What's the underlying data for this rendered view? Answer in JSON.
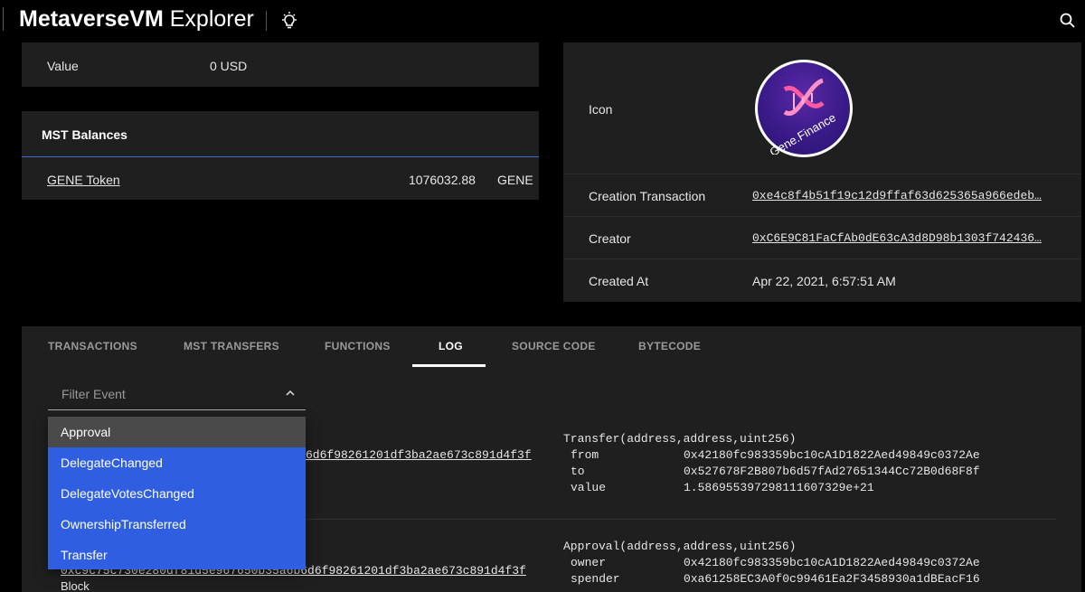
{
  "header": {
    "brand_bold": "MetaverseVM",
    "brand_light": " Explorer"
  },
  "value_card": {
    "label": "Value",
    "value": "0 USD"
  },
  "balances": {
    "title": "MST Balances",
    "rows": [
      {
        "token": "GENE Token",
        "amount": "1076032.88",
        "symbol": "GENE"
      }
    ]
  },
  "info": {
    "icon_label": "Icon",
    "logo_text": "Gene.Finance",
    "creation_tx_label": "Creation Transaction",
    "creation_tx_value": "0xe4c8f4b51f19c12d9ffaf63d625365a966edeb…",
    "creator_label": "Creator",
    "creator_value": "0xC6E9C81FaCfAb0dE63cA3d8D98b1303f742436…",
    "created_at_label": "Created At",
    "created_at_value": "Apr 22, 2021, 6:57:51 AM"
  },
  "tabs": [
    "TRANSACTIONS",
    "MST TRANSFERS",
    "FUNCTIONS",
    "LOG",
    "SOURCE CODE",
    "BYTECODE"
  ],
  "active_tab": "LOG",
  "filter": {
    "placeholder": "Filter Event"
  },
  "dropdown": {
    "options": [
      "Approval",
      "DelegateChanged",
      "DelegateVotesChanged",
      "OwnershipTransferred",
      "Transfer"
    ],
    "highlighted": "Approval"
  },
  "logs": [
    {
      "hash_partial": "6d6f98261201df3ba2ae673c891d4f3f",
      "event": "Transfer(address,address,uint256)",
      "params": [
        {
          "name": "from",
          "value": "0x42180fc983359bc10cA1D1822Aed49849c0372Ae"
        },
        {
          "name": "to",
          "value": "0x527678F2B807b6d57fAd27651344Cc72B0d68F8f"
        },
        {
          "name": "value",
          "value": "1.586955397298111607329e+21"
        }
      ]
    },
    {
      "hash_full": "0xc9c75c730e280df81d5e967650b35a6b6d6f98261201df3ba2ae673c891d4f3f",
      "block_label": "Block",
      "event": "Approval(address,address,uint256)",
      "params": [
        {
          "name": "owner",
          "value": "0x42180fc983359bc10cA1D1822Aed49849c0372Ae"
        },
        {
          "name": "spender",
          "value": "0xa61258EC3A0f0c99461Ea2F3458930a1dBEacF16"
        }
      ]
    }
  ]
}
